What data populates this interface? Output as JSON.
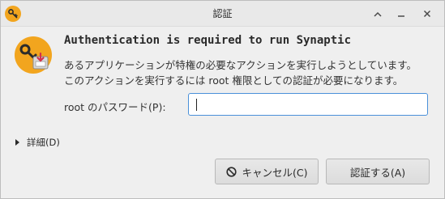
{
  "window": {
    "title": "認証",
    "icon": "key-icon",
    "controls": [
      "chevron-up-icon",
      "minimize-icon",
      "close-icon"
    ]
  },
  "dialog": {
    "icon": "password-key-icon",
    "heading": "Authentication is required to run Synaptic",
    "description_line1": "あるアプリケーションが特権の必要なアクションを実行しようとしています。",
    "description_line2": "このアクションを実行するには root 権限としての認証が必要になります。",
    "password_label": "root のパスワード(P):",
    "password_value": "",
    "details_label": "詳細(D)"
  },
  "buttons": {
    "cancel_label": "キャンセル(C)",
    "authenticate_label": "認証する(A)"
  },
  "colors": {
    "accent": "#4a90d9",
    "key_orange": "#f2a51e"
  }
}
